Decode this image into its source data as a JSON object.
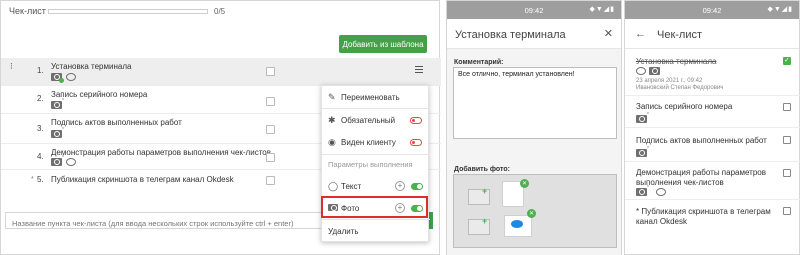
{
  "left": {
    "title": "Чек-лист",
    "progress_text": "0/5",
    "progress_fraction": 0,
    "add_button": "Добавить из шаблона",
    "items": [
      {
        "num": "1.",
        "label": "Установка терминала"
      },
      {
        "num": "2.",
        "label": "Запись серийного номера"
      },
      {
        "num": "3.",
        "label": "Подпись актов выполненных работ"
      },
      {
        "num": "4.",
        "label": "Демонстрация работы параметров выполнения чек-листов"
      },
      {
        "num": "5.",
        "label": "Публикация скриншота в телеграм канал Okdesk",
        "star": "*"
      }
    ],
    "input_placeholder": "Название пункта чек-листа (для ввода нескольких строк используйте ctrl + enter)",
    "menu": {
      "rename": "Переименовать",
      "required": "Обязательный",
      "visible": "Виден клиенту",
      "section": "Параметры выполнения",
      "text": "Текст",
      "photo": "Фото",
      "delete": "Удалить",
      "plus": "+"
    }
  },
  "middle": {
    "time": "09:42",
    "status_icons": "◆▼◢▮",
    "title": "Установка терминала",
    "close": "✕",
    "comment_label": "Комментарий:",
    "comment_text": "Все отлично, терминал установлен!",
    "photo_label": "Добавить фото:"
  },
  "right": {
    "time": "09:42",
    "status_icons": "◆▼◢▮",
    "back": "←",
    "title": "Чек-лист",
    "items": [
      {
        "label": "Установка терминала",
        "done": true,
        "date": "23 апреля 2021 г., 09:42",
        "author": "Ивановский Степан Федорович"
      },
      {
        "label": "Запись серийного номера",
        "done": false
      },
      {
        "label": "Подпись актов выполненных работ",
        "done": false
      },
      {
        "label": "Демонстрация работы параметров выполнения чек-листов",
        "done": false
      },
      {
        "label": "Публикация скриншота в телеграм канал Okdesk",
        "done": false,
        "star": "*"
      }
    ]
  },
  "colors": {
    "accent_green": "#45a049",
    "highlight_red": "#d9302c",
    "status_bar": "#9e9e9e"
  }
}
